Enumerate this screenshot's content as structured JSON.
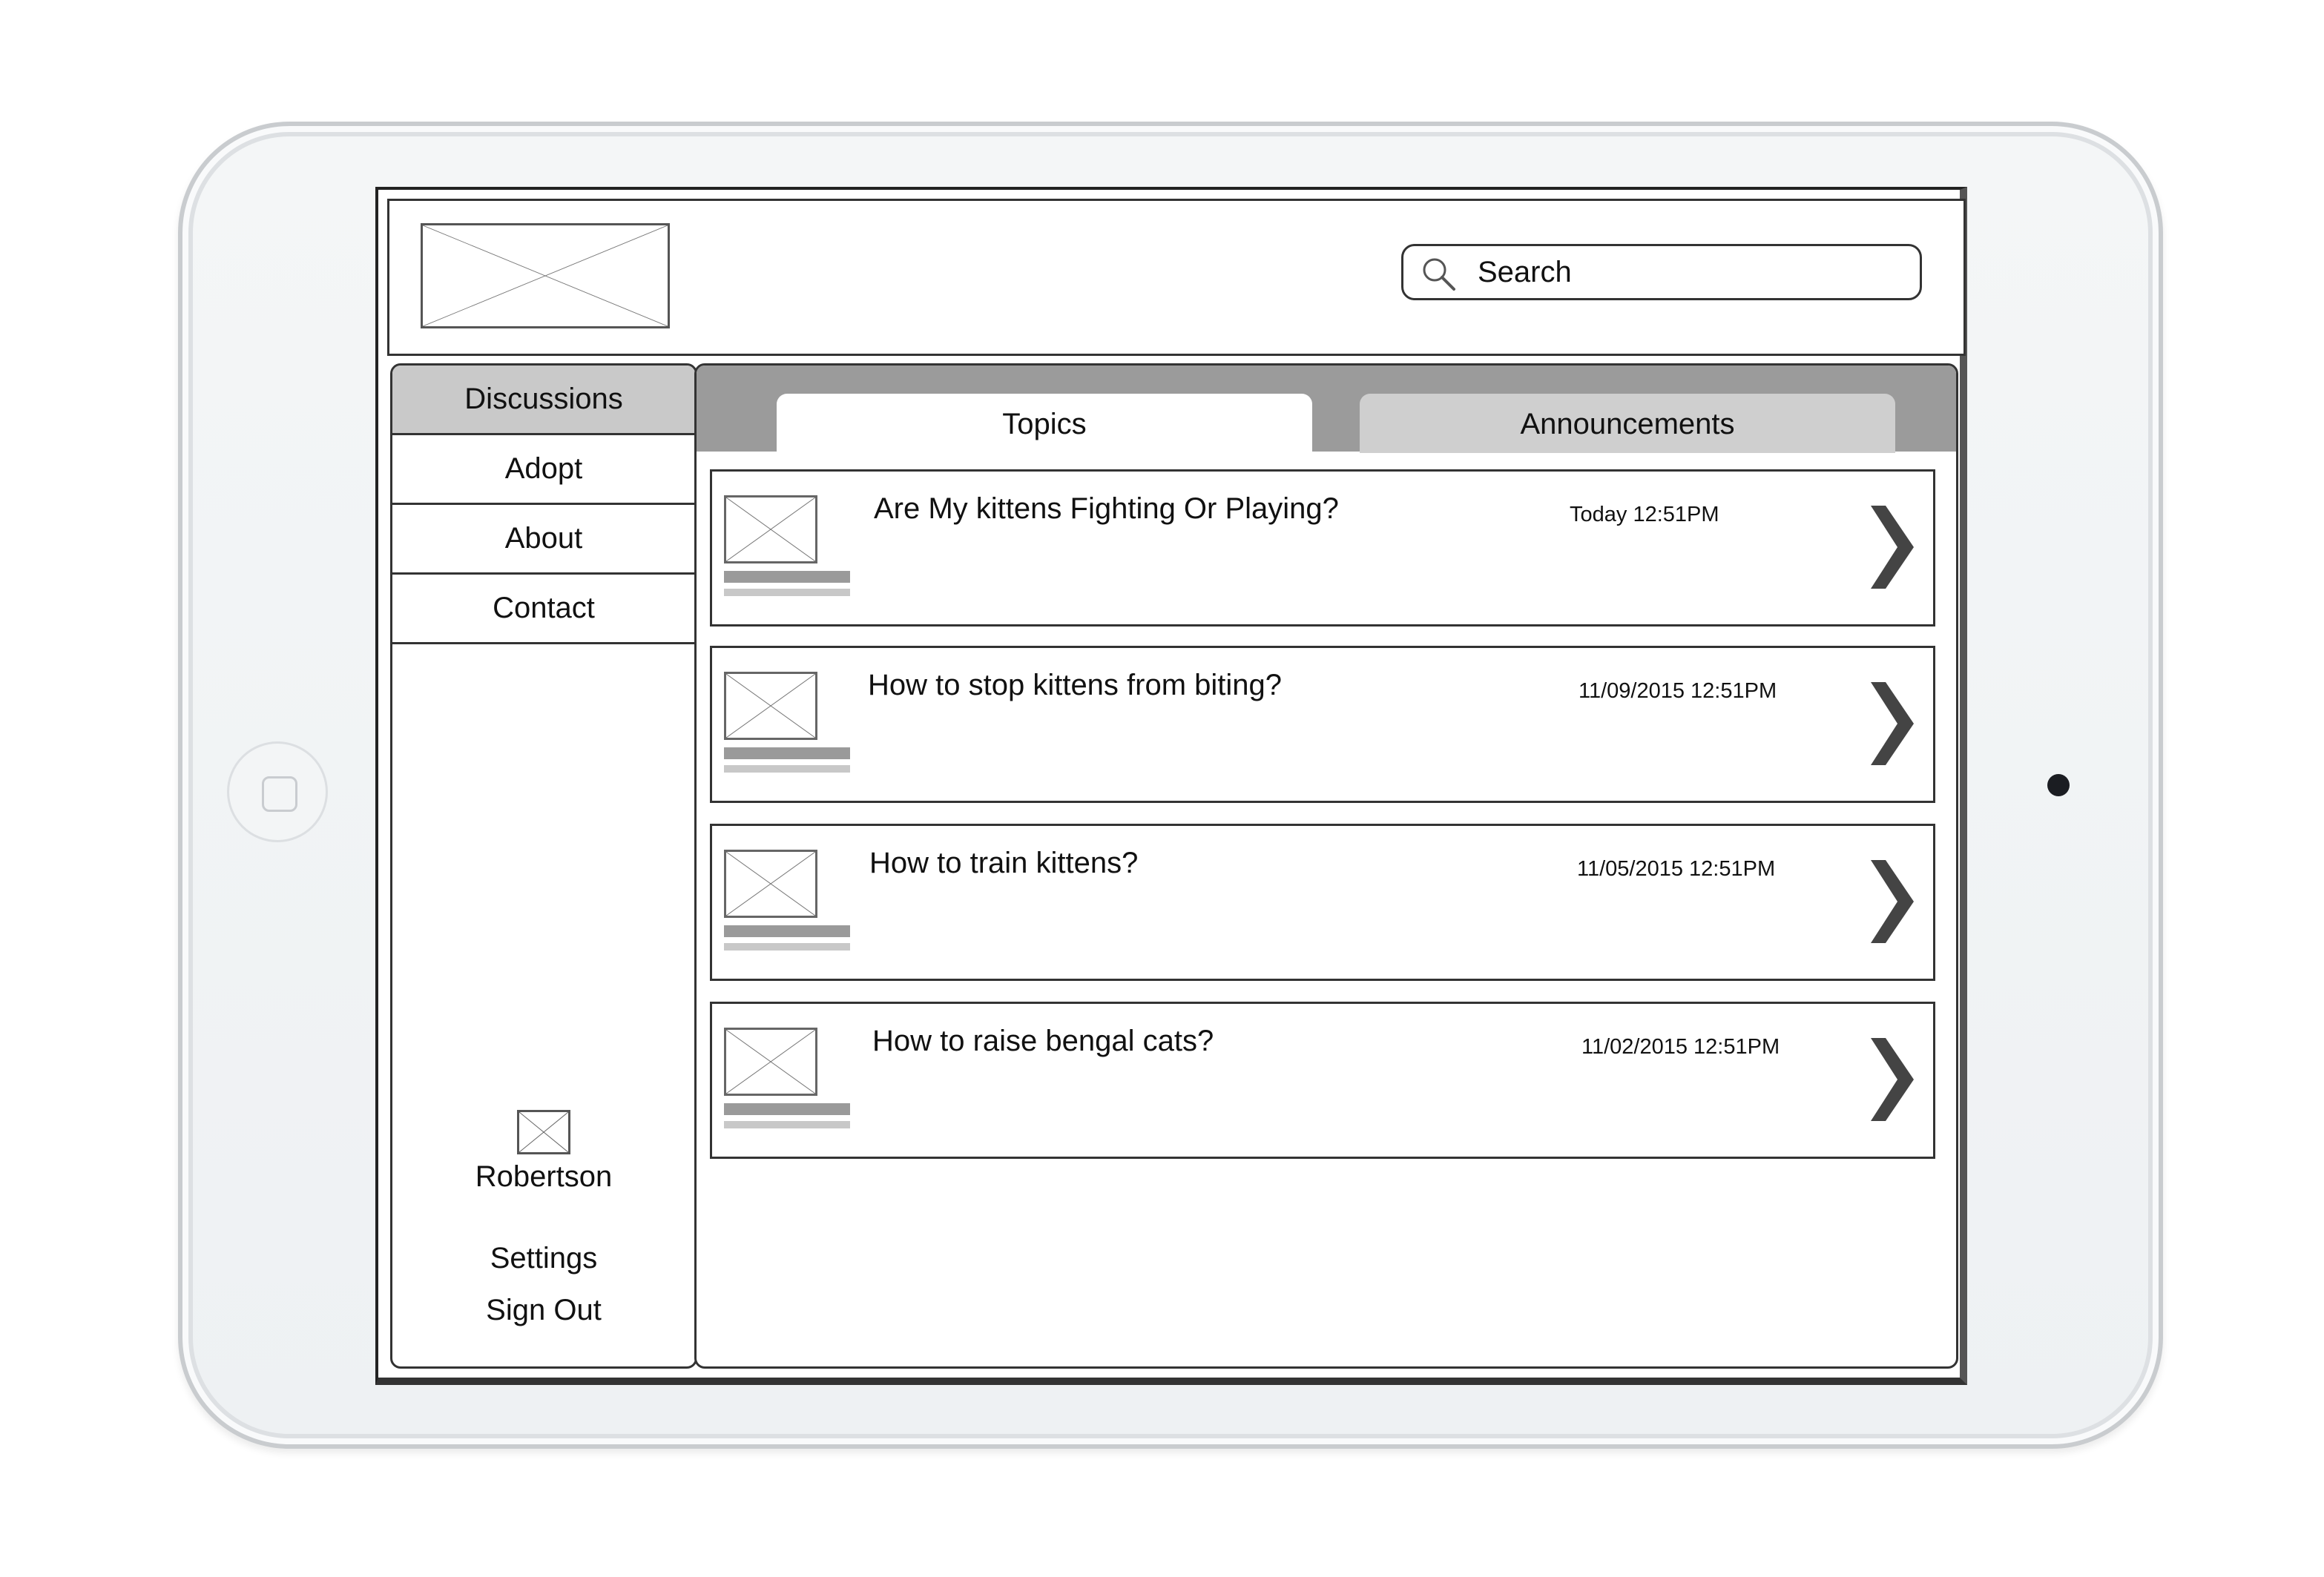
{
  "header": {
    "search_placeholder": "Search",
    "logo_icon": "image-placeholder-icon",
    "search_icon": "magnifier-icon"
  },
  "sidebar": {
    "items": [
      {
        "label": "Discussions",
        "active": true
      },
      {
        "label": "Adopt",
        "active": false
      },
      {
        "label": "About",
        "active": false
      },
      {
        "label": "Contact",
        "active": false
      }
    ],
    "user": {
      "name": "Robertson",
      "avatar_icon": "image-placeholder-icon"
    },
    "settings_label": "Settings",
    "signout_label": "Sign Out"
  },
  "tabs": [
    {
      "label": "Topics",
      "active": true
    },
    {
      "label": "Announcements",
      "active": false
    }
  ],
  "topics": [
    {
      "title": "Are My kittens Fighting Or Playing?",
      "date": "Today 12:51PM",
      "thumb_icon": "image-placeholder-icon",
      "arrow_icon": "chevron-right-icon"
    },
    {
      "title": "How to stop kittens from biting?",
      "date": "11/09/2015 12:51PM",
      "thumb_icon": "image-placeholder-icon",
      "arrow_icon": "chevron-right-icon"
    },
    {
      "title": "How to train kittens?",
      "date": "11/05/2015 12:51PM",
      "thumb_icon": "image-placeholder-icon",
      "arrow_icon": "chevron-right-icon"
    },
    {
      "title": "How to raise bengal cats?",
      "date": "11/02/2015 12:51PM",
      "thumb_icon": "image-placeholder-icon",
      "arrow_icon": "chevron-right-icon"
    }
  ],
  "colors": {
    "tabbar_bg": "#9b9b9b",
    "active_nav_bg": "#c9c9c9",
    "inactive_tab_bg": "#cfcfcf",
    "chevron": "#444444"
  }
}
